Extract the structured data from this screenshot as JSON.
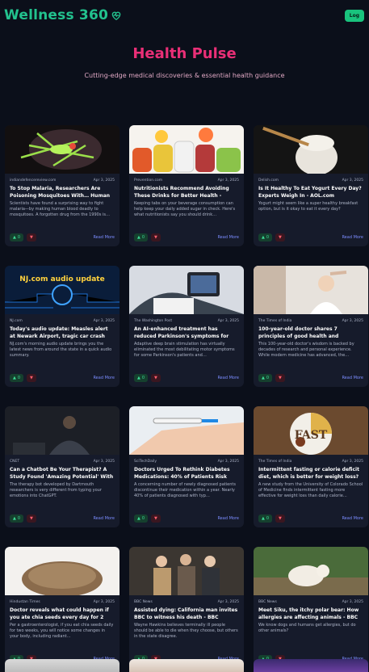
{
  "header": {
    "logo_text": "Wellness 360",
    "login_label": "Log"
  },
  "hero": {
    "title": "Health Pulse",
    "subtitle": "Cutting-edge medical discoveries & essential health guidance"
  },
  "read_more": "Read More",
  "cards": [
    {
      "source": "indiandefencereview.com",
      "date": "Apr 3, 2025",
      "title": "To Stop Malaria, Researchers Are Poisoning Mosquitoes With… Human Bloo…",
      "desc": "Scientists have found a surprising way to fight malaria—by making human blood deadly to mosquitoes. A forgotten drug from the 1990s is…",
      "likes": "0"
    },
    {
      "source": "Prevention.com",
      "date": "Apr 3, 2025",
      "title": "Nutritionists Recommend Avoiding These Drinks for Better Health - AOL.com",
      "desc": "Keeping tabs on your beverage consumption can help keep your daily added sugar in check. Here's what nutritionists say you should drink…",
      "likes": "0"
    },
    {
      "source": "Delish.com",
      "date": "Apr 3, 2025",
      "title": "Is It Healthy To Eat Yogurt Every Day? Experts Weigh In - AOL.com",
      "desc": "Yogurt might seem like a super healthy breakfast option, but is it okay to eat it every day?",
      "likes": "0"
    },
    {
      "source": "NJ.com",
      "date": "Apr 3, 2025",
      "title": "Today's audio update: Measles alert at Newark Airport, tragic car crash in…",
      "desc": "NJ.com's morning audio update brings you the latest news from around the state in a quick audio summary.",
      "likes": "0"
    },
    {
      "source": "The Washington Post",
      "date": "Apr 3, 2025",
      "title": "An AI-enhanced treatment has reduced Parkinson's symptoms for some people -…",
      "desc": "Adaptive deep brain stimulation has virtually eliminated the most debilitating motor symptoms for some Parkinson's patients and…",
      "likes": "0"
    },
    {
      "source": "The Times of India",
      "date": "Apr 3, 2025",
      "title": "100-year-old doctor shares 7 principles of good health and longevity - Times of India",
      "desc": "This 100-year-old doctor's wisdom is backed by decades of research and personal experience. While modern medicine has advanced, the…",
      "likes": "0"
    },
    {
      "source": "CNET",
      "date": "Apr 3, 2025",
      "title": "Can a Chatbot Be Your Therapist? A Study Found 'Amazing Potential' With the Right…",
      "desc": "The therapy bot developed by Dartmouth researchers is very different from typing your emotions into ChatGPT.",
      "likes": "0"
    },
    {
      "source": "SciTechDaily",
      "date": "Apr 3, 2025",
      "title": "Doctors Urged To Rethink Diabetes Medications: 40% of Patients Risk Their…",
      "desc": "A concerning number of newly diagnosed patients discontinue their medication within a year. Nearly 40% of patients diagnosed with typ…",
      "likes": "0"
    },
    {
      "source": "The Times of India",
      "date": "Apr 3, 2025",
      "title": "Intermittent fasting or calorie deficit diet, which is better for weight loss? -…",
      "desc": "A new study from the University of Colorado School of Medicine finds intermittent fasting more effective for weight loss than daily calorie…",
      "likes": "0"
    },
    {
      "source": "Hindustan Times",
      "date": "Apr 3, 2025",
      "title": "Doctor reveals what could happen if you ate chia seeds every day for 2 weeks:…",
      "desc": "Per a gastroenterologist, if you eat chia seeds daily for two weeks, you will notice some changes in your body, including radiant…",
      "likes": "0"
    },
    {
      "source": "BBC News",
      "date": "Apr 3, 2025",
      "title": "Assisted dying: California man invites BBC to witness his death - BBC",
      "desc": "Wayne Hawkins believes terminally ill people should be able to die when they choose, but others in the state disagree.",
      "likes": "0"
    },
    {
      "source": "BBC News",
      "date": "Apr 3, 2025",
      "title": "Meet Siku, the itchy polar bear: How allergies are affecting animals - BBC",
      "desc": "We know dogs and humans get allergies, but do other animals?",
      "likes": "0"
    }
  ],
  "thumb_text": {
    "nj": "NJ.com audio update",
    "fast": "FAST"
  },
  "colors": {
    "brand": "#22c28e",
    "accent": "#ea2f77",
    "background": "#0b0f1a",
    "card": "#161b2b"
  }
}
